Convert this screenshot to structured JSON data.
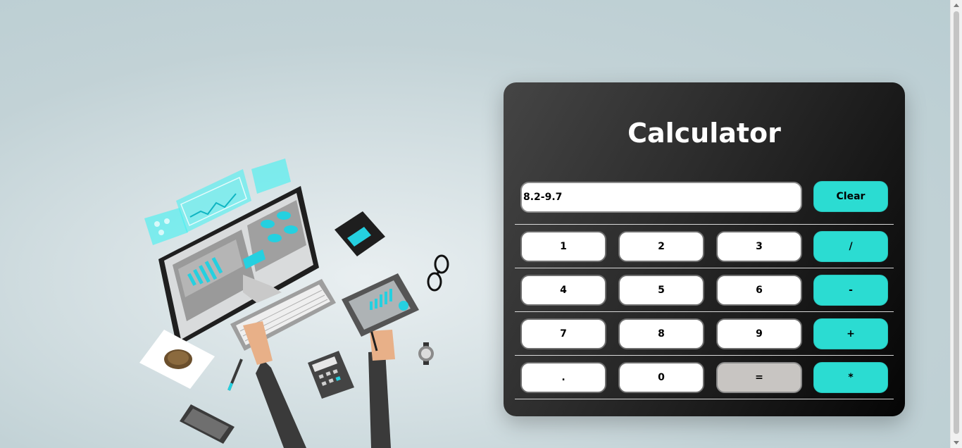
{
  "calculator": {
    "title": "Calculator",
    "display_value": "8.2-9.7",
    "clear_label": "Clear",
    "rows": [
      [
        {
          "label": "1",
          "kind": "num"
        },
        {
          "label": "2",
          "kind": "num"
        },
        {
          "label": "3",
          "kind": "num"
        },
        {
          "label": "/",
          "kind": "op"
        }
      ],
      [
        {
          "label": "4",
          "kind": "num"
        },
        {
          "label": "5",
          "kind": "num"
        },
        {
          "label": "6",
          "kind": "num"
        },
        {
          "label": "-",
          "kind": "op"
        }
      ],
      [
        {
          "label": "7",
          "kind": "num"
        },
        {
          "label": "8",
          "kind": "num"
        },
        {
          "label": "9",
          "kind": "num"
        },
        {
          "label": "+",
          "kind": "op"
        }
      ],
      [
        {
          "label": ".",
          "kind": "num"
        },
        {
          "label": "0",
          "kind": "num"
        },
        {
          "label": "=",
          "kind": "eq"
        },
        {
          "label": "*",
          "kind": "op"
        }
      ]
    ]
  },
  "colors": {
    "accent": "#2bdcd2",
    "equals_button": "#c8c5c2",
    "panel_dark": "#050505",
    "page_background": "#b9cdd2"
  },
  "illustration": {
    "description_icons": [
      "computer-monitor-icon",
      "keyboard-icon",
      "tablet-icon",
      "calculator-icon",
      "smartphone-icon",
      "coffee-cup-icon",
      "eyeglasses-icon",
      "wristwatch-icon",
      "notebook-icon",
      "pen-icon"
    ]
  }
}
